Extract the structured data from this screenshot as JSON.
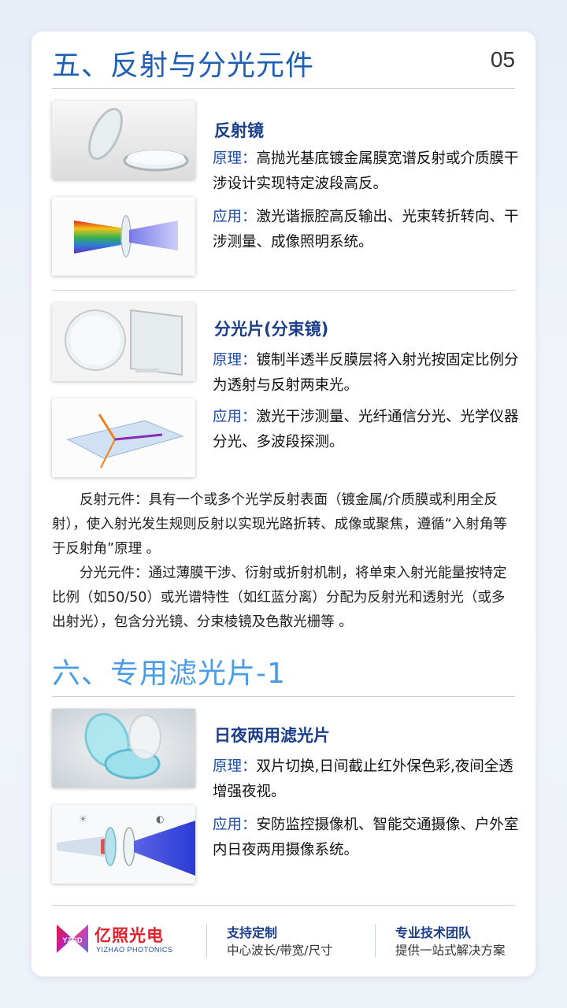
{
  "section5": {
    "title": "五、反射与分光元件",
    "page_no": "05"
  },
  "products": [
    {
      "title": "反射镜",
      "principle_label": "原理：",
      "principle": "高抛光基底镀金属膜宽谱反射或介质膜干涉设计实现特定波段高反。",
      "application_label": "应用：",
      "application": "激光谐振腔高反输出、光束转折转向、干涉测量、成像照明系统。"
    },
    {
      "title": "分光片(分束镜)",
      "principle_label": "原理：",
      "principle": "镀制半透半反膜层将入射光按固定比例分为透射与反射两束光。",
      "application_label": "应用：",
      "application": "激光干涉测量、光纤通信分光、光学仪器分光、多波段探测。"
    },
    {
      "title": "日夜两用滤光片",
      "principle_label": "原理：",
      "principle": "双片切换,日间截止红外保色彩,夜间全透增强夜视。",
      "application_label": "应用：",
      "application": "安防监控摄像机、智能交通摄像、户外室内日夜两用摄像系统。"
    }
  ],
  "description": {
    "p1": "反射元件：具有一个或多个光学反射表面（镀金属/介质膜或利用全反射），使入射光发生规则反射以实现光路折转、成像或聚焦，遵循“入射角等于反射角”原理 。",
    "p2": "分光元件：通过薄膜干涉、衍射或折射机制，将单束入射光能量按特定比例（如50/50）或光谱特性（如红蓝分离）分配为反射光和透射光（或多出射光），包含分光镜、分束棱镜及色散光栅等 。"
  },
  "section6": {
    "title": "六、专用滤光片-1"
  },
  "footer": {
    "logo_badge": "YZGD",
    "brand_cn": "亿照光电",
    "brand_en": "YIZHAO PHOTONICS",
    "feature1_title": "支持定制",
    "feature1_sub": "中心波长/带宽/尺寸",
    "feature2_title": "专业技术团队",
    "feature2_sub": "提供一站式解决方案"
  },
  "colors": {
    "heading_dark": "#1f5fb5",
    "heading_light": "#4a9be6",
    "label_blue": "#1f4ca0",
    "brand_red": "#e0212a"
  }
}
